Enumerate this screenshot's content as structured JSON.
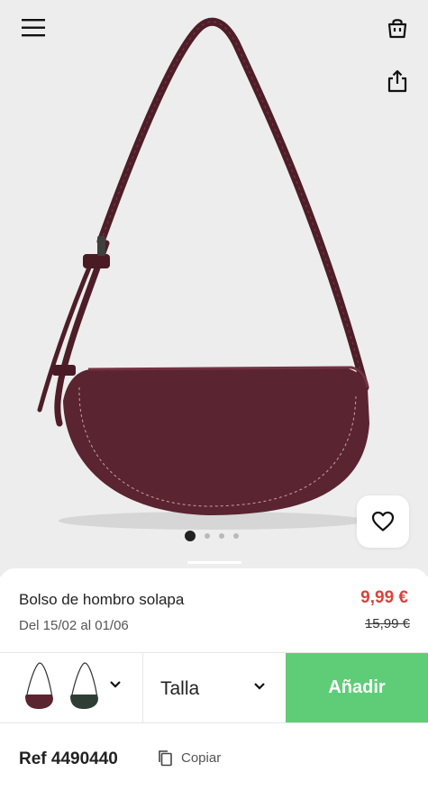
{
  "header": {
    "menu_icon": "hamburger-menu-icon",
    "cart_icon": "shopping-bag-icon",
    "share_icon": "share-icon"
  },
  "gallery": {
    "image_count": 4,
    "active_index": 0,
    "favorite_icon": "heart-icon"
  },
  "product": {
    "name": "Bolso de hombro solapa",
    "dates": "Del 15/02 al 01/06",
    "price": "9,99 €",
    "old_price": "15,99 €",
    "reference": "Ref 4490440",
    "copy_label": "Copiar",
    "copy_icon": "copy-icon"
  },
  "actions": {
    "variants": [
      {
        "color": "#5a2430",
        "name": "burgundy"
      },
      {
        "color": "#2f3e34",
        "name": "green"
      }
    ],
    "size_label": "Talla",
    "add_label": "Añadir"
  },
  "colors": {
    "bag": "#5a2430",
    "sale_price": "#d6453d",
    "add_button": "#5fcd78"
  }
}
